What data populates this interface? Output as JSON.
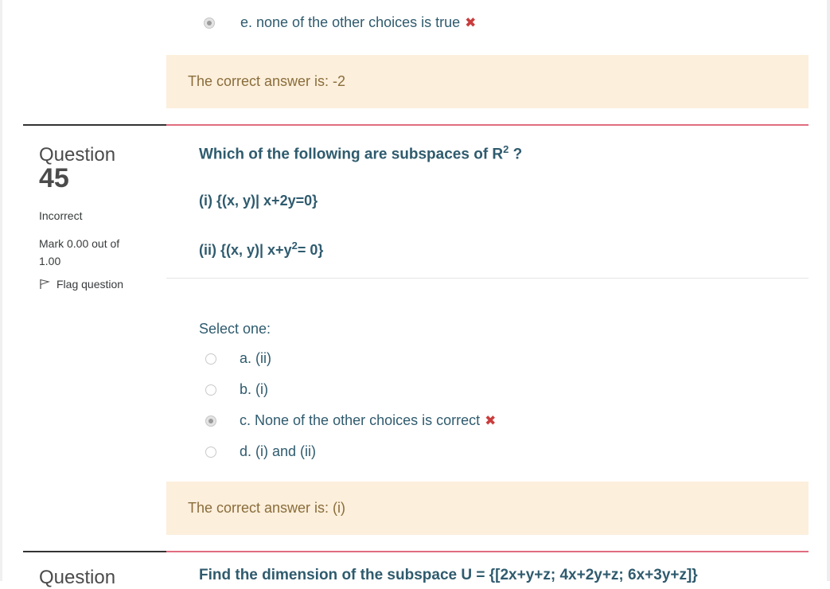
{
  "prev_question": {
    "selected_option": "e. none of the other choices is true",
    "feedback": "The correct answer is: -2"
  },
  "question": {
    "label": "Question",
    "number": "45",
    "state": "Incorrect",
    "grade": "Mark 0.00 out of 1.00",
    "flag_label": "Flag question",
    "text": "Which of the following are subspaces of R",
    "text_sup": "2",
    "text_end": " ?",
    "part_i": "(i) {(x, y)| x+2y=0}",
    "part_ii_a": "(ii) {(x, y)| x+y",
    "part_ii_sup": "2",
    "part_ii_b": "= 0}",
    "select_one": "Select one:",
    "options": [
      {
        "label": "a. (ii)",
        "checked": false
      },
      {
        "label": "b. (i)",
        "checked": false
      },
      {
        "label": "c. None of the other choices is correct",
        "checked": true,
        "incorrect": true
      },
      {
        "label": "d. (i) and (ii)",
        "checked": false
      }
    ],
    "feedback": "The correct answer is: (i)"
  },
  "next_question": {
    "label": "Question",
    "text_partial": "Find the dimension of the subspace U = {[2x+y+z; 4x+2y+z; 6x+3y+z]}"
  },
  "colors": {
    "link_blue": "#2f5b6e",
    "feedback_bg": "#fcefdc",
    "feedback_text": "#8a6d3b",
    "incorrect_red": "#ca3c3c",
    "separator_red": "#e16d7f"
  }
}
